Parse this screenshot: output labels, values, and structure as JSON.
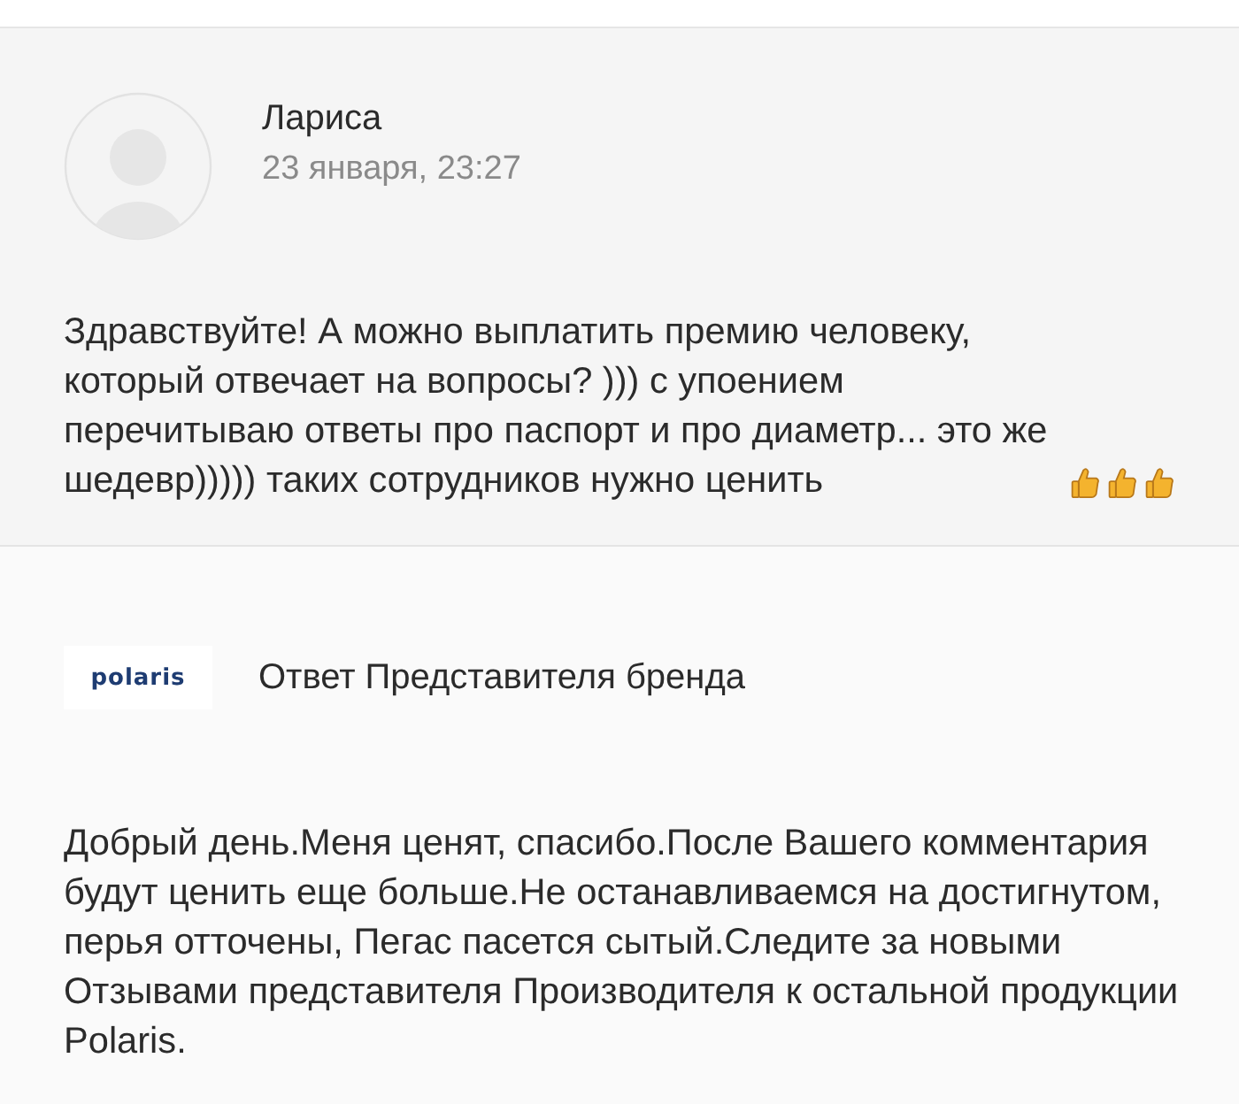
{
  "comment": {
    "author": "Лариса",
    "date": "23 января, 23:27",
    "text": "Здравствуйте! А можно выплатить премию человеку, который отвечает на вопросы? ))) с упоением перечитываю ответы про паспорт и про диаметр... это же шедевр))))) таких сотрудников нужно ценить"
  },
  "reply": {
    "logo": "polaris",
    "author": "Ответ Представителя бренда",
    "text": "Добрый день.Меня ценят, спасибо.После Вашего комментария будут ценить еще больше.Не останавливаемся на достигнутом, перья отточены, Пегас пасется сытый.Следите за новыми Отзывами представителя Производителя к остальной продукции Polaris."
  }
}
